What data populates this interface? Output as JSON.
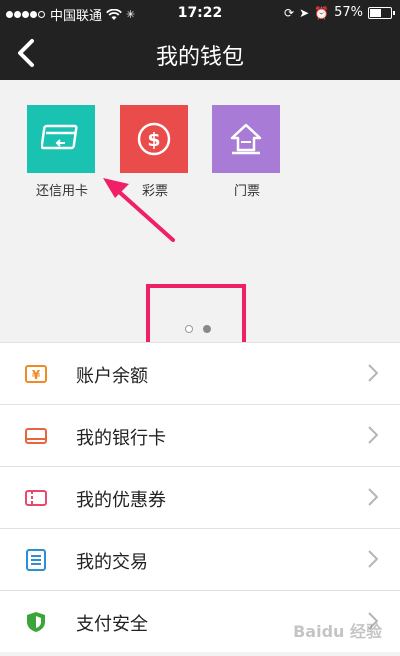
{
  "status_bar": {
    "carrier": "中国联通",
    "time": "17:22",
    "battery": "57%"
  },
  "nav": {
    "title": "我的钱包"
  },
  "tiles": [
    {
      "label": "还信用卡",
      "icon": "credit-card-icon",
      "color": "#19c2b1"
    },
    {
      "label": "彩票",
      "icon": "lottery-dollar-icon",
      "color": "#ea4b4b"
    },
    {
      "label": "门票",
      "icon": "ticket-house-icon",
      "color": "#a77bd6"
    }
  ],
  "pager": {
    "total": 2,
    "current": 2
  },
  "menu": [
    {
      "label": "账户余额",
      "icon": "yuan-balance-icon",
      "color": "#f08a24"
    },
    {
      "label": "我的银行卡",
      "icon": "bank-card-icon",
      "color": "#e8643c"
    },
    {
      "label": "我的优惠券",
      "icon": "coupon-icon",
      "color": "#e84a6f"
    },
    {
      "label": "我的交易",
      "icon": "transactions-list-icon",
      "color": "#2f8fd6"
    },
    {
      "label": "支付安全",
      "icon": "security-shield-icon",
      "color": "#3aa63a"
    }
  ],
  "watermark": "Baidu 经验"
}
